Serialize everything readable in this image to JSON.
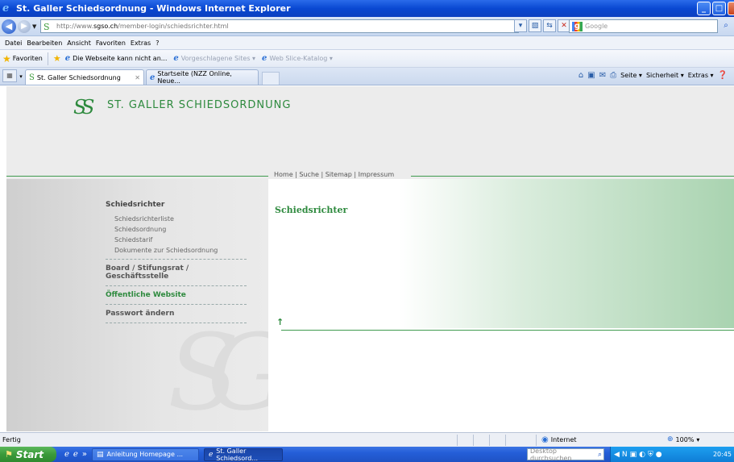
{
  "window": {
    "title": "St. Galler Schiedsordnung - Windows Internet Explorer",
    "buttons": {
      "minimize": "_",
      "maximize": "□",
      "close": ""
    }
  },
  "address_bar": {
    "url_prefix": "http://www.",
    "url_host": "sgso.ch",
    "url_path": "/member-login/schiedsrichter.html",
    "search_placeholder": "Google"
  },
  "menu": {
    "items": [
      "Datei",
      "Bearbeiten",
      "Ansicht",
      "Favoriten",
      "Extras",
      "?"
    ]
  },
  "favorites_bar": {
    "label": "Favoriten",
    "items": [
      {
        "label": "Die Webseite kann nicht an...",
        "icon": "ie-icon"
      },
      {
        "label": "Vorgeschlagene Sites ▾",
        "icon": "ie-icon"
      },
      {
        "label": "Web Slice-Katalog ▾",
        "icon": "ie-icon"
      }
    ]
  },
  "tabs": [
    {
      "label": "St. Galler Schiedsordnung",
      "active": true
    },
    {
      "label": "Startseite (NZZ Online, Neue...",
      "active": false
    }
  ],
  "command_bar": {
    "items": [
      "Seite ▾",
      "Sicherheit ▾",
      "Extras ▾"
    ]
  },
  "page": {
    "site_title": "ST. GALLER SCHIEDSORDNUNG",
    "top_nav": "Home | Suche | Sitemap | Impressum",
    "side_nav": {
      "heading": "Schiedsrichter",
      "subitems": [
        "Schiedsrichterliste",
        "Schiedsordnung",
        "Schiedstarif",
        "Dokumente zur Schiedsordnung"
      ],
      "links": [
        {
          "label": "Board / Stifungsrat / Geschäftsstelle",
          "color": "#555555"
        },
        {
          "label": "Öffentliche Website",
          "color": "#2e8a3e"
        },
        {
          "label": "Passwort ändern",
          "color": "#555555"
        }
      ]
    },
    "heading": "Schiedsrichter",
    "up_arrow": "↑",
    "accent_color": "#2e8a3e"
  },
  "status_bar": {
    "status": "Fertig",
    "zone": "Internet",
    "zoom": "100%"
  },
  "taskbar": {
    "start": "Start",
    "tasks": [
      {
        "label": "Anleitung Homepage ..."
      },
      {
        "label": "St. Galler Schiedsord..."
      }
    ],
    "desktop_search": "Desktop durchsuchen",
    "clock": "20:45"
  }
}
